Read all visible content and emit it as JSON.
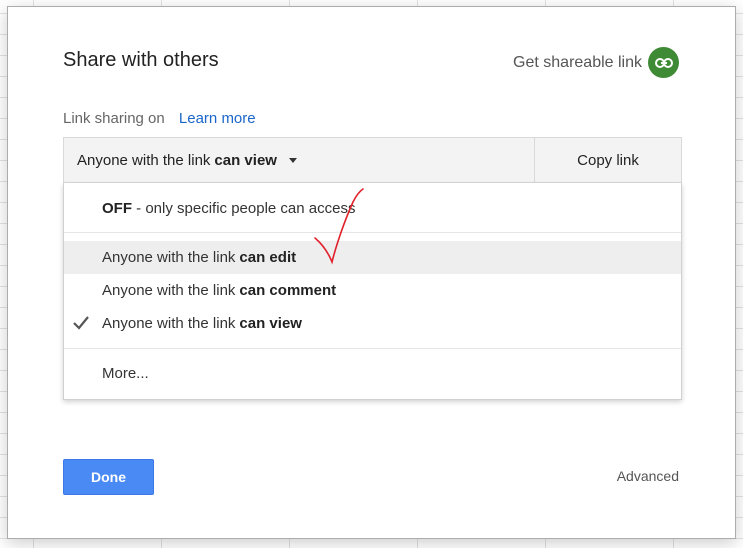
{
  "dialog": {
    "title": "Share with others",
    "shareable_link_label": "Get shareable link",
    "link_sharing_label": "Link sharing on",
    "learn_more_label": "Learn more",
    "access_prefix": "Anyone with the link",
    "access_current": "can view",
    "copy_link_label": "Copy link",
    "done_label": "Done",
    "advanced_label": "Advanced"
  },
  "menu": {
    "off_bold": "OFF",
    "off_rest": " - only specific people can access",
    "options": [
      {
        "prefix": "Anyone with the link",
        "level": "can edit",
        "highlighted": true,
        "checked": false
      },
      {
        "prefix": "Anyone with the link",
        "level": "can comment",
        "highlighted": false,
        "checked": false
      },
      {
        "prefix": "Anyone with the link",
        "level": "can view",
        "highlighted": false,
        "checked": true
      }
    ],
    "more_label": "More..."
  },
  "colors": {
    "accent_green": "#3f8a34",
    "done_blue": "#4a8af4",
    "link_blue": "#1a66c9",
    "annotation_red": "#e0202a"
  }
}
